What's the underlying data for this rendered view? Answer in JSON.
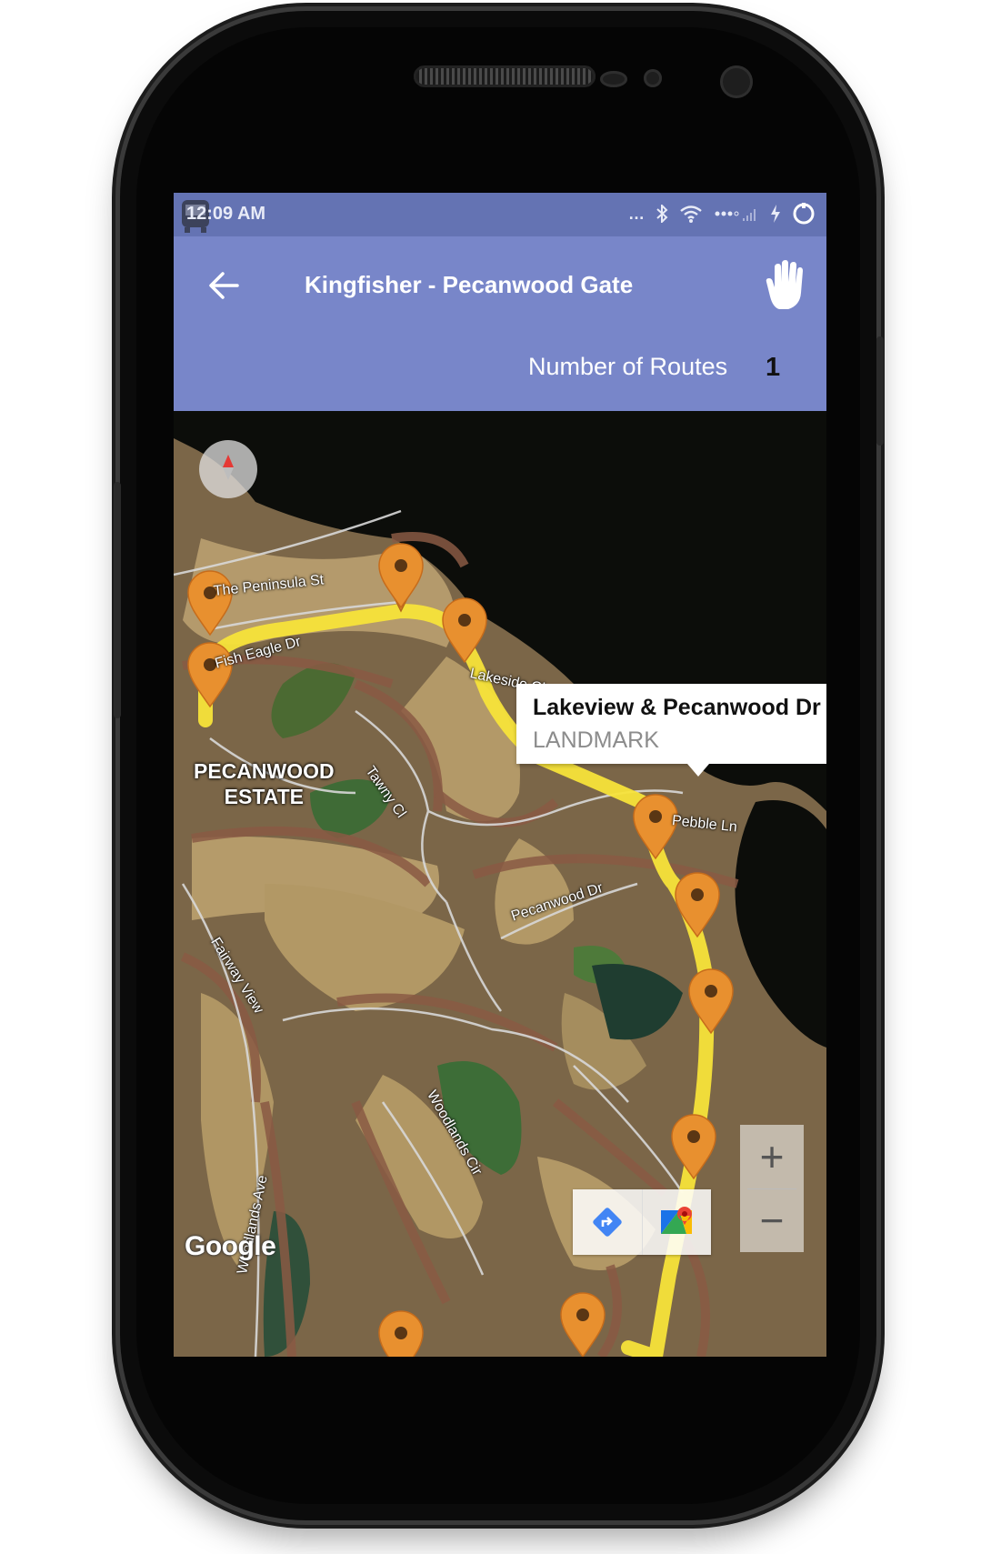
{
  "status_bar": {
    "time": "12:09 AM",
    "icons": [
      "bus-icon",
      "more-dots-icon",
      "bluetooth-icon",
      "wifi-icon",
      "signal-icon",
      "charging-icon",
      "loading-icon"
    ]
  },
  "app_bar": {
    "title": "Kingfisher - Pecanwood Gate",
    "routes_label": "Number of Routes",
    "routes_count": "1",
    "back_icon": "arrow-left-icon",
    "stop_icon": "hand-icon",
    "color": "#7886c9",
    "status_color": "#6473b3"
  },
  "map": {
    "info_window": {
      "title": "Lakeview & Pecanwood Dr",
      "subtitle": "LANDMARK"
    },
    "labels": {
      "peninsula": "The Peninsula St",
      "fish_eagle": "Fish Eagle Dr",
      "lakeside": "Lakeside Cl",
      "tawny": "Tawny Cl",
      "pebble": "Pebble Ln",
      "pecanwood_dr": "Pecanwood Dr",
      "fairway": "Fairway View",
      "woodlands_cir": "Woodlands Cir",
      "woodlands_ave": "Woodlands Ave",
      "estate_line1": "PECANWOOD",
      "estate_line2": "ESTATE"
    },
    "attribution": "Google",
    "zoom_in": "+",
    "zoom_out": "−",
    "route_color": "#f7e33a",
    "marker_color": "#e8902f"
  }
}
